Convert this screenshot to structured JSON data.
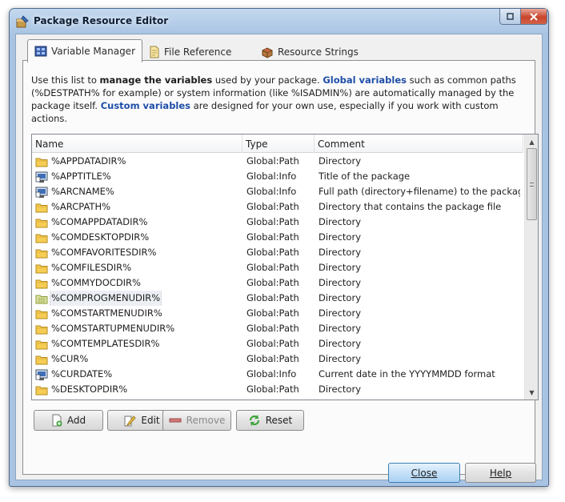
{
  "window": {
    "title": "Package Resource Editor"
  },
  "tabs": [
    {
      "label": "Variable Manager",
      "active": true
    },
    {
      "label": "File Reference",
      "active": false
    },
    {
      "label": "Resource Strings",
      "active": false
    }
  ],
  "description": {
    "p1": "Use this list to ",
    "b1": "manage the variables",
    "p2": " used by your package. ",
    "h1": "Global variables",
    "p3": " such as common paths (%DESTPATH% for example) or system information (like %ISADMIN%) are automatically managed by the package itself. ",
    "h2": "Custom variables",
    "p4": " are designed for your own use, especially if you work with custom actions."
  },
  "list": {
    "columns": [
      "Name",
      "Type",
      "Comment"
    ],
    "rows": [
      {
        "icon": "folder-icon",
        "name": "%APPDATADIR%",
        "type": "Global:Path",
        "comment": "Directory"
      },
      {
        "icon": "info-icon",
        "name": "%APPTITLE%",
        "type": "Global:Info",
        "comment": "Title of the package"
      },
      {
        "icon": "info-icon",
        "name": "%ARCNAME%",
        "type": "Global:Info",
        "comment": "Full path (directory+filename) to the package..."
      },
      {
        "icon": "folder-icon",
        "name": "%ARCPATH%",
        "type": "Global:Path",
        "comment": "Directory that contains the package file"
      },
      {
        "icon": "folder-icon",
        "name": "%COMAPPDATADIR%",
        "type": "Global:Path",
        "comment": "Directory"
      },
      {
        "icon": "folder-icon",
        "name": "%COMDESKTOPDIR%",
        "type": "Global:Path",
        "comment": "Directory"
      },
      {
        "icon": "folder-icon",
        "name": "%COMFAVORITESDIR%",
        "type": "Global:Path",
        "comment": "Directory"
      },
      {
        "icon": "folder-icon",
        "name": "%COMFILESDIR%",
        "type": "Global:Path",
        "comment": "Directory"
      },
      {
        "icon": "folder-icon",
        "name": "%COMMYDOCDIR%",
        "type": "Global:Path",
        "comment": "Directory"
      },
      {
        "icon": "folder-selected-icon",
        "name": "%COMPROGMENUDIR%",
        "type": "Global:Path",
        "comment": "Directory",
        "selected": true
      },
      {
        "icon": "folder-icon",
        "name": "%COMSTARTMENUDIR%",
        "type": "Global:Path",
        "comment": "Directory"
      },
      {
        "icon": "folder-icon",
        "name": "%COMSTARTUPMENUDIR%",
        "type": "Global:Path",
        "comment": "Directory"
      },
      {
        "icon": "folder-icon",
        "name": "%COMTEMPLATESDIR%",
        "type": "Global:Path",
        "comment": "Directory"
      },
      {
        "icon": "folder-icon",
        "name": "%CUR%",
        "type": "Global:Path",
        "comment": "Directory"
      },
      {
        "icon": "info-icon",
        "name": "%CURDATE%",
        "type": "Global:Info",
        "comment": "Current date in the YYYYMMDD format"
      },
      {
        "icon": "folder-icon",
        "name": "%DESKTOPDIR%",
        "type": "Global:Path",
        "comment": "Directory"
      }
    ]
  },
  "actions": {
    "add": "Add",
    "edit": "Edit",
    "remove": "Remove",
    "reset": "Reset"
  },
  "footer": {
    "close": "Close",
    "help": "Help"
  },
  "colors": {
    "accent": "#1f4ea8",
    "frame": "#a9c3e2",
    "close_button": "#c9442a"
  }
}
